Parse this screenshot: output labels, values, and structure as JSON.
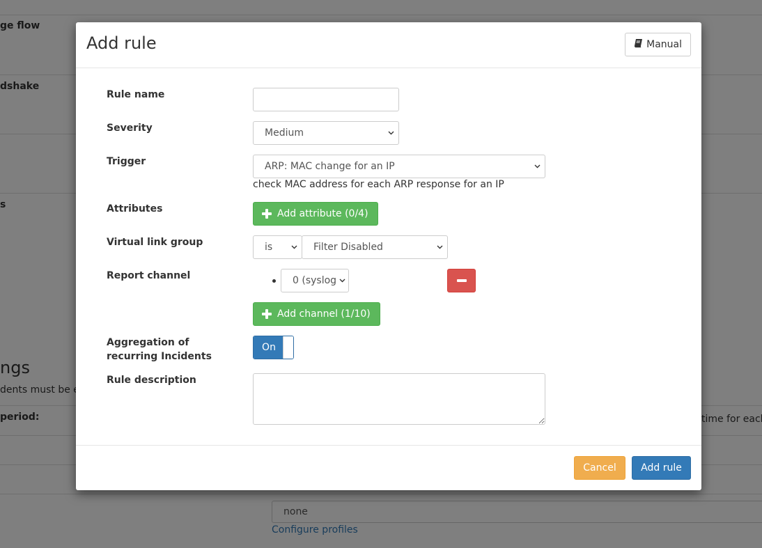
{
  "background": {
    "labels": [
      "ge flow",
      "dshake",
      "s",
      "period:"
    ],
    "heading": "ngs",
    "note": "dents must be e",
    "right_text": "time for each",
    "profile_value": "none",
    "configure_link": "Configure profiles"
  },
  "modal": {
    "title": "Add rule",
    "manual_label": "Manual",
    "fields": {
      "rule_name": {
        "label": "Rule name",
        "value": ""
      },
      "severity": {
        "label": "Severity",
        "value": "Medium"
      },
      "trigger": {
        "label": "Trigger",
        "value": "ARP: MAC change for an IP",
        "help": "check MAC address for each ARP response for an IP"
      },
      "attributes": {
        "label": "Attributes",
        "button": "Add attribute (0/4)"
      },
      "virtual_link_group": {
        "label": "Virtual link group",
        "operator": "is",
        "value": "Filter Disabled"
      },
      "report_channel": {
        "label": "Report channel",
        "channel_value": "0 (syslog",
        "add_button": "Add channel (1/10)"
      },
      "aggregation": {
        "label_line1": "Aggregation of",
        "label_line2": "recurring Incidents",
        "toggle": "On"
      },
      "description": {
        "label": "Rule description",
        "value": ""
      }
    },
    "footer": {
      "cancel": "Cancel",
      "submit": "Add rule"
    }
  },
  "colors": {
    "primary": "#337ab7",
    "success": "#5cb85c",
    "danger": "#d9534f",
    "warning": "#f0ad4e"
  }
}
